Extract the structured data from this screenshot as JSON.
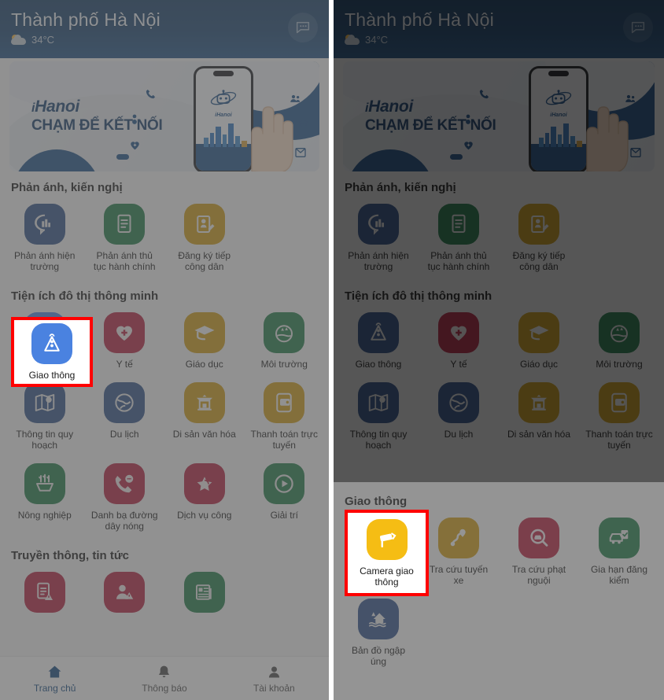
{
  "app": {
    "header": {
      "city_title": "Thành phố Hà Nội",
      "temperature": "34°C",
      "weather_icon": "cloud-sun-icon",
      "chat_icon": "chat-bubble-icon"
    },
    "banner": {
      "logo": "Hanoi",
      "logo_prefix": "i",
      "tagline": "CHẠM ĐỂ KẾT NỐI",
      "alt": "iHanoi promotional banner with phone and hand"
    },
    "sections": [
      {
        "id": "phan-anh-kien-nghi",
        "title": "Phản ánh, kiến nghị",
        "items": [
          {
            "label": "Phản ánh hiện trường",
            "icon": "speech-city-icon",
            "color": "#2e4f87"
          },
          {
            "label": "Phản ánh thủ tục hành chính",
            "icon": "documents-icon",
            "color": "#1f7a46"
          },
          {
            "label": "Đăng ký tiếp công dân",
            "icon": "id-card-pencil-icon",
            "color": "#cc9a12"
          }
        ]
      },
      {
        "id": "tien-ich-do-thi-thong-minh",
        "title": "Tiện ích đô thị thông minh",
        "items": [
          {
            "label": "Giao thông",
            "icon": "traffic-light-icon",
            "color": "#4a82e0",
            "highlighted": true
          },
          {
            "label": "Y tế",
            "icon": "heart-cross-icon",
            "color": "#b41f3e"
          },
          {
            "label": "Giáo dục",
            "icon": "graduation-cap-icon",
            "color": "#cc9a12"
          },
          {
            "label": "Môi trường",
            "icon": "eco-globe-icon",
            "color": "#1f7a46"
          },
          {
            "label": "Thông tin quy hoạch",
            "icon": "map-pin-icon",
            "color": "#2e4f87"
          },
          {
            "label": "Du lịch",
            "icon": "globe-travel-icon",
            "color": "#2e4f87"
          },
          {
            "label": "Di sản văn hóa",
            "icon": "temple-icon",
            "color": "#cc9a12"
          },
          {
            "label": "Thanh toán trực tuyến",
            "icon": "wallet-phone-icon",
            "color": "#cc9a12"
          },
          {
            "label": "Nông nghiệp",
            "icon": "agriculture-icon",
            "color": "#1f7a46"
          },
          {
            "label": "Danh bạ đường dây nóng",
            "icon": "hotline-phone-icon",
            "color": "#b41f3e"
          },
          {
            "label": "Dịch vụ công",
            "icon": "public-service-star-icon",
            "color": "#b41f3e"
          },
          {
            "label": "Giải trí",
            "icon": "play-circle-icon",
            "color": "#1f7a46"
          }
        ]
      },
      {
        "id": "truyen-thong-tin-tuc",
        "title": "Truyền thông, tin tức",
        "items": [
          {
            "label": "",
            "icon": "document-alert-icon",
            "color": "#b41f3e"
          },
          {
            "label": "",
            "icon": "person-alert-icon",
            "color": "#b41f3e"
          },
          {
            "label": "",
            "icon": "newspaper-icon",
            "color": "#1f7a46"
          }
        ]
      }
    ],
    "sheet": {
      "title": "Giao thông",
      "items": [
        {
          "label": "Camera giao thông",
          "icon": "cctv-camera-icon",
          "color": "#f5bd14",
          "highlighted": true
        },
        {
          "label": "Tra cứu tuyến xe",
          "icon": "bus-route-icon",
          "color": "#cc9a12"
        },
        {
          "label": "Tra cứu phạt nguội",
          "icon": "car-search-icon",
          "color": "#b41f3e"
        },
        {
          "label": "Gia hạn đăng kiểm",
          "icon": "vehicle-inspection-icon",
          "color": "#1f7a46"
        },
        {
          "label": "Bản đồ ngập úng",
          "icon": "flood-house-icon",
          "color": "#2e4f87"
        }
      ]
    },
    "bottom_nav": [
      {
        "label": "Trang chủ",
        "icon": "home-icon",
        "active": true
      },
      {
        "label": "Thông báo",
        "icon": "bell-icon",
        "active": false
      },
      {
        "label": "Tài khoản",
        "icon": "person-icon",
        "active": false
      }
    ],
    "colors": {
      "header_bg": "#16416e",
      "highlight_border": "#ff0000",
      "active_nav": "#11477f",
      "page_bg": "#f2f2f2"
    }
  }
}
